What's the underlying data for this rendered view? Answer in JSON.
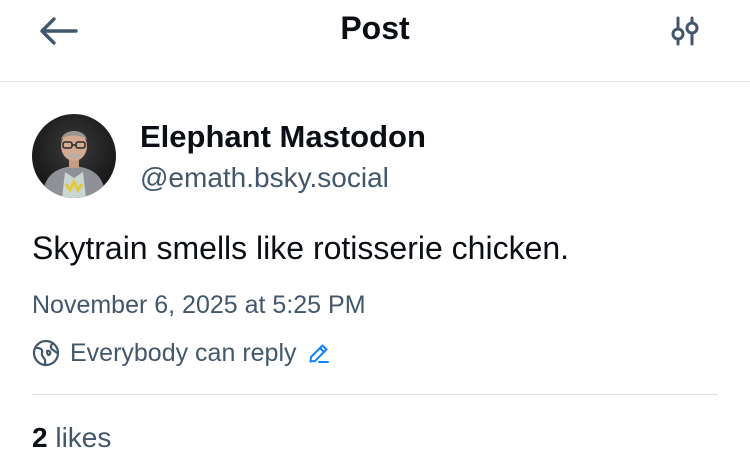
{
  "header": {
    "title": "Post",
    "back_icon": "arrow-left-icon",
    "filter_icon": "sliders-icon"
  },
  "post": {
    "author": {
      "display_name": "Elephant Mastodon",
      "handle": "@emath.bsky.social"
    },
    "text": "Skytrain smells like rotisserie chicken.",
    "timestamp": "November 6, 2025 at 5:25 PM",
    "reply_setting": {
      "label": "Everybody can reply",
      "icon": "globe-icon",
      "edit_icon": "pencil-icon"
    },
    "likes": {
      "count": "2",
      "label": "likes"
    }
  },
  "colors": {
    "text_primary": "#0b0f14",
    "text_secondary": "#42576c",
    "accent": "#1083fe",
    "divider": "#dfe3e8"
  }
}
